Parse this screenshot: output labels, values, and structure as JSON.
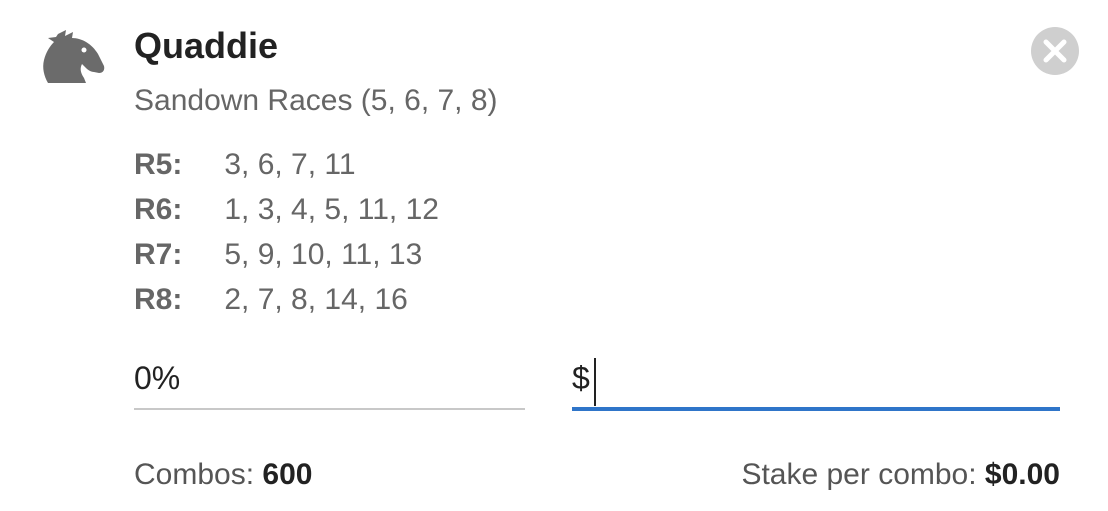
{
  "header": {
    "icon": "horse-head-icon",
    "title": "Quaddie",
    "subtitle": "Sandown Races (5, 6, 7, 8)",
    "close_icon": "close-icon"
  },
  "legs": [
    {
      "label": "R5:",
      "runners": "3, 6, 7, 11"
    },
    {
      "label": "R6:",
      "runners": "1, 3, 4, 5, 11, 12"
    },
    {
      "label": "R7:",
      "runners": "5, 9, 10, 11, 13"
    },
    {
      "label": "R8:",
      "runners": "2, 7, 8, 14, 16"
    }
  ],
  "inputs": {
    "percent_value": "0%",
    "stake_prefix": "$",
    "stake_value": ""
  },
  "footer": {
    "combos_label": "Combos:",
    "combos_value": "600",
    "stake_label": "Stake per combo:",
    "stake_value": "$0.00"
  },
  "colors": {
    "accent": "#2f75c9",
    "icon_grey": "#6b6b6b",
    "close_bg": "#cfcfcf"
  }
}
